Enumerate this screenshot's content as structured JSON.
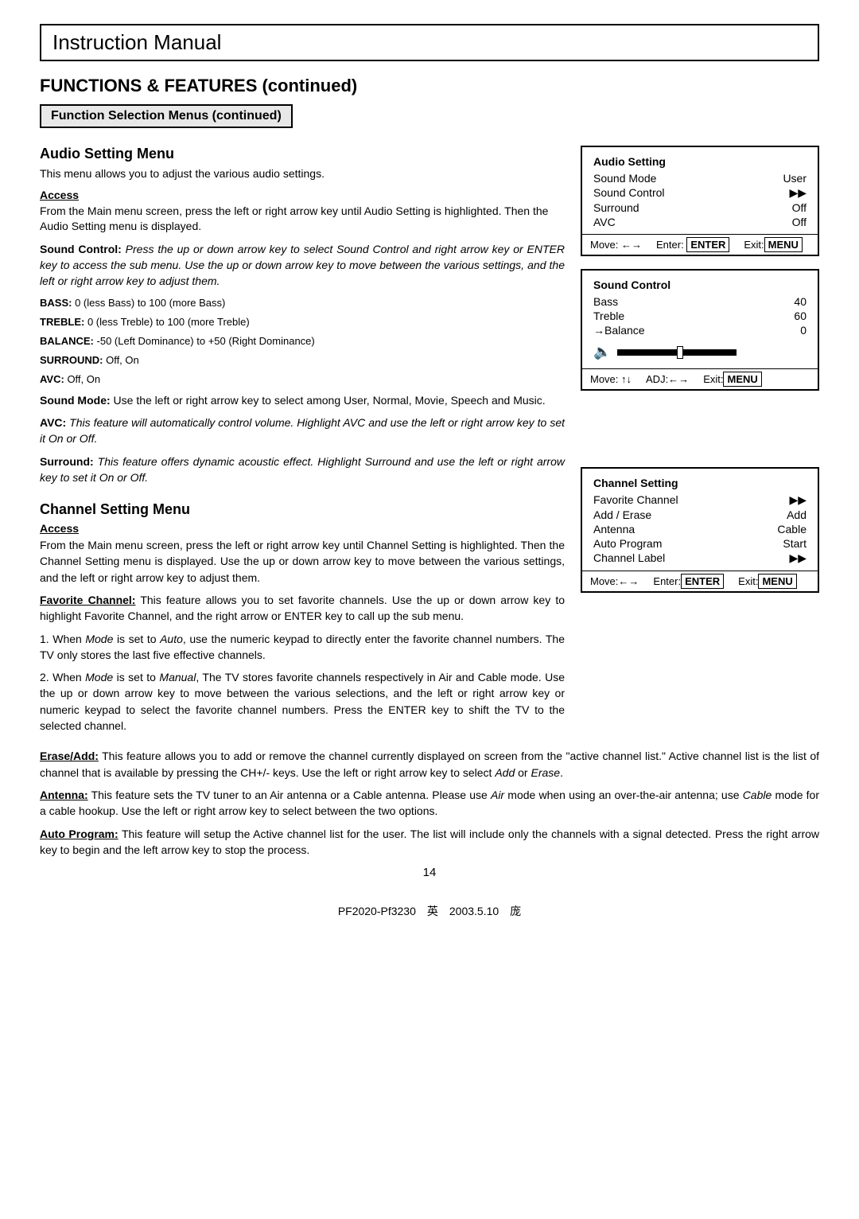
{
  "header": {
    "title": "Instruction Manual"
  },
  "main_title": "FUNCTIONS & FEATURES (continued)",
  "section_label": "Function Selection Menus (continued)",
  "audio_setting_menu": {
    "title": "Audio Setting Menu",
    "intro": "This menu allows you to adjust the various audio settings.",
    "access_label": "Access",
    "access_text": "From the Main menu screen, press the left or right arrow key until Audio Setting is highlighted. Then the Audio Setting menu is displayed.",
    "sound_control_bold": "Sound Control:",
    "sound_control_text": " Press the up or down arrow key to select Sound Control and right arrow key or ENTER key to access the sub menu. Use the up or down arrow key to move between the various settings, and the left or right arrow key to adjust them.",
    "bass_label": "BASS:",
    "bass_text": "0 (less Bass) to 100 (more Bass)",
    "treble_label": "TREBLE:",
    "treble_text": "0 (less Treble) to 100 (more Treble)",
    "balance_label": "BALANCE:",
    "balance_text": "-50 (Left Dominance) to +50 (Right Dominance)",
    "surround_label": "SURROUND:",
    "surround_text": "Off, On",
    "avc_label": "AVC:",
    "avc_text": "Off, On",
    "sound_mode_bold": "Sound Mode:",
    "sound_mode_text": " Use the left or right arrow key to select among User, Normal, Movie, Speech and Music.",
    "avc_bold": "AVC:",
    "avc_desc": " This feature will automatically control volume. Highlight AVC and use the left or right arrow key to set it On or Off.",
    "surround_bold": "Surround:",
    "surround_desc": " This feature offers dynamic acoustic effect. Highlight Surround and use the left or right arrow key to set it On or Off."
  },
  "audio_menu_box": {
    "title": "Audio Setting",
    "rows": [
      {
        "label": "Sound Mode",
        "value": "User"
      },
      {
        "label": "Sound Control",
        "value": "▶▶",
        "selected": false
      },
      {
        "label": "Surround",
        "value": "Off"
      },
      {
        "label": "AVC",
        "value": "Off"
      }
    ],
    "footer_move": "Move: ←→",
    "footer_enter": "Enter:",
    "footer_enter_box": "ENTER",
    "footer_exit": "Exit:",
    "footer_exit_box": "MENU"
  },
  "sound_control_box": {
    "title": "Sound Control",
    "rows": [
      {
        "label": "Bass",
        "value": "40"
      },
      {
        "label": "Treble",
        "value": "60"
      },
      {
        "label": "→Balance",
        "value": "0",
        "selected": false
      }
    ],
    "footer_move": "Move: ↑↓",
    "footer_adj": "ADJ:←→",
    "footer_exit": "Exit:",
    "footer_exit_box": "MENU"
  },
  "channel_setting_menu": {
    "title": "Channel Setting Menu",
    "access_label": "Access",
    "access_text": "From the Main menu screen, press the left or right arrow key until Channel Setting is highlighted. Then the Channel Setting menu is displayed. Use the up or down arrow key to move between the various settings, and the left or right arrow key to adjust them.",
    "favorite_bold": "Favorite Channel:",
    "favorite_text": " This feature allows you to set favorite channels. Use the up or down arrow key to highlight Favorite Channel, and the right arrow or ENTER key to call up the sub menu.",
    "note1_prefix": "1. When ",
    "note1_mode": "Mode",
    "note1_text": " is set to ",
    "note1_auto": "Auto",
    "note1_rest": ", use the numeric keypad to directly enter the favorite channel numbers. The TV only stores the last five effective channels.",
    "note2_prefix": "2. When ",
    "note2_mode": "Mode",
    "note2_text": " is set to ",
    "note2_manual": "Manual",
    "note2_rest": ", The TV stores favorite channels respectively in Air and Cable mode. Use the up or down arrow key to move between the various selections, and the left or right arrow key or numeric keypad to select the favorite channel numbers. Press the ENTER key to shift the TV to the selected channel.",
    "erase_bold": "Erase/Add:",
    "erase_text": " This feature allows you to add or remove the channel currently displayed on screen from the \"active channel list.\" Active channel list is the list of channel that is available by pressing the CH+/- keys. Use the left or right arrow key to select ",
    "erase_add": "Add",
    "erase_or": " or ",
    "erase_erase": "Erase",
    "erase_end": ".",
    "antenna_bold": "Antenna:",
    "antenna_text": " This feature sets the TV tuner to an Air antenna or a Cable antenna. Please use ",
    "antenna_air": "Air",
    "antenna_mid": " mode when using an over-the-air antenna; use ",
    "antenna_cable": "Cable",
    "antenna_rest": " mode for a cable hookup. Use the left or right arrow key to select between the two options.",
    "auto_prog_bold": "Auto Program:",
    "auto_prog_text": " This feature will setup the Active channel list for the user. The list will include only the channels with a signal detected. Press the right arrow key to begin and the left arrow key to stop the process."
  },
  "channel_menu_box": {
    "title": "Channel Setting",
    "rows": [
      {
        "label": "Favorite Channel",
        "value": "▶▶"
      },
      {
        "label": "Add / Erase",
        "value": "Add"
      },
      {
        "label": "Antenna",
        "value": "Cable"
      },
      {
        "label": "Auto Program",
        "value": "Start"
      },
      {
        "label": "Channel Label",
        "value": "▶▶"
      }
    ],
    "footer_move": "Move:←→",
    "footer_enter": "Enter:",
    "footer_enter_box": "ENTER",
    "footer_exit": "Exit:",
    "footer_exit_box": "MENU"
  },
  "page_number": "14",
  "bottom_note": "PF2020-Pf3230　英　2003.5.10　庞"
}
